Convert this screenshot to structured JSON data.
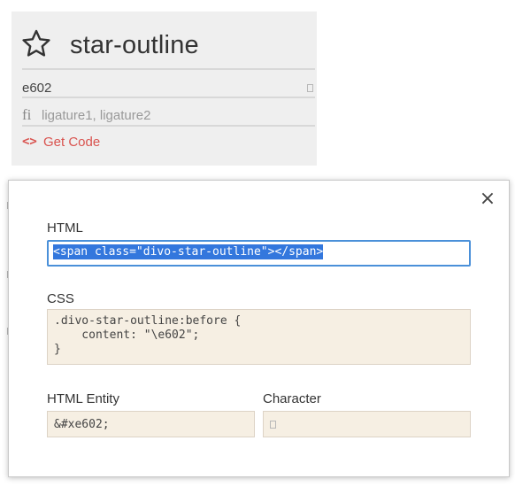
{
  "icon_card": {
    "title": "star-outline",
    "icon": "star-outline-icon",
    "code": "e602",
    "ligatures": "ligature1, ligature2",
    "ligature_icon": "fi",
    "get_code_icon": "<>",
    "get_code_label": "Get Code",
    "accent_color": "#d9534f"
  },
  "modal": {
    "close_icon": "×",
    "html_label": "HTML",
    "html_value": "<span class=\"divo-star-outline\"></span>",
    "css_label": "CSS",
    "css_value": ".divo-star-outline:before {\n    content: \"\\e602\";\n}",
    "entity_label": "HTML Entity",
    "entity_value": "&#xe602;",
    "character_label": "Character",
    "selection_color": "#3377dd"
  }
}
